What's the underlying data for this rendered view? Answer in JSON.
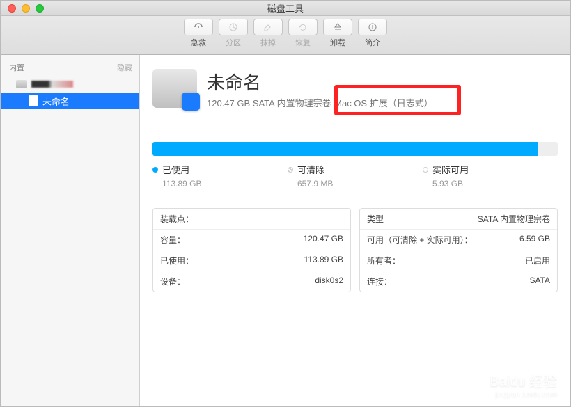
{
  "window": {
    "title": "磁盘工具"
  },
  "toolbar": {
    "first_aid": "急救",
    "partition": "分区",
    "erase": "抹掉",
    "restore": "恢复",
    "unmount": "卸载",
    "info": "简介"
  },
  "sidebar": {
    "header": "内置",
    "hide": "隐藏",
    "volume": "未命名"
  },
  "volume": {
    "name": "未命名",
    "desc_a": "120.47 GB SATA 内置物理宗卷",
    "desc_b": "Mac OS 扩展（日志式）"
  },
  "legend": {
    "used_label": "已使用",
    "used_value": "113.89 GB",
    "purgeable_label": "可清除",
    "purgeable_value": "657.9 MB",
    "free_label": "实际可用",
    "free_value": "5.93 GB"
  },
  "left_table": {
    "mount_k": "装载点：",
    "mount_v": "",
    "capacity_k": "容量：",
    "capacity_v": "120.47 GB",
    "used_k": "已使用：",
    "used_v": "113.89 GB",
    "device_k": "设备：",
    "device_v": "disk0s2"
  },
  "right_table": {
    "type_k": "类型",
    "type_v": "SATA 内置物理宗卷",
    "avail_k": "可用（可清除 + 实际可用）：",
    "avail_v": "6.59 GB",
    "owners_k": "所有者：",
    "owners_v": "已启用",
    "conn_k": "连接：",
    "conn_v": "SATA"
  },
  "watermark": {
    "brand": "Baidu 经验",
    "url": "jingyan.baidu.com"
  }
}
